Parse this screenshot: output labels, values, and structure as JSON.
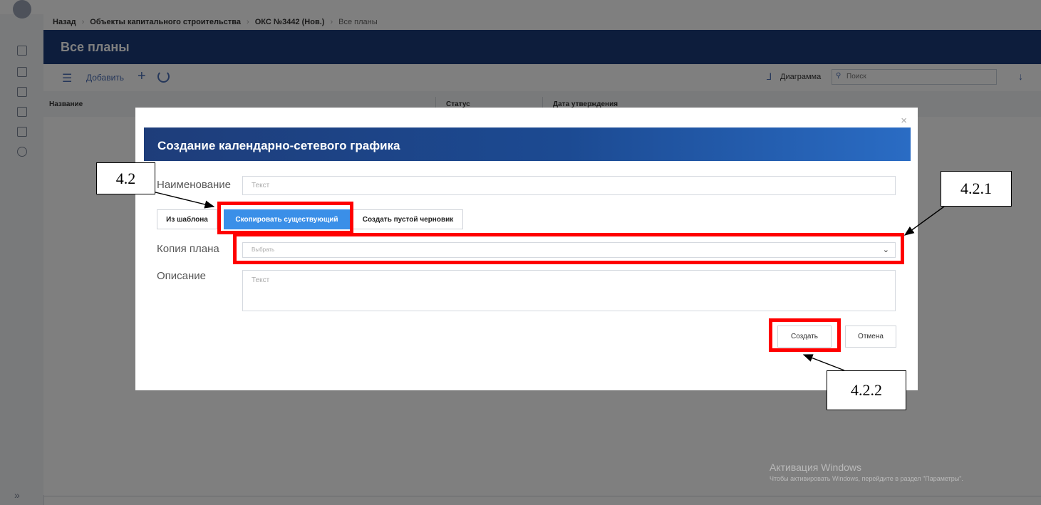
{
  "breadcrumb": {
    "back": "Назад",
    "items": [
      "Объекты капитального строительства",
      "ОКС №3442 (Нов.)"
    ],
    "current": "Все планы"
  },
  "page": {
    "title": "Все планы"
  },
  "toolbar": {
    "add_label": "Добавить",
    "diagram_label": "Диаграмма",
    "search_placeholder": "Поиск"
  },
  "table": {
    "columns": [
      "Название",
      "Статус",
      "Дата утверждения"
    ]
  },
  "modal": {
    "title": "Создание календарно-сетевого графика",
    "name_label": "Наименование",
    "name_placeholder": "Текст",
    "tabs": [
      "Из шаблона",
      "Скопировать существующий",
      "Создать пустой черновик"
    ],
    "active_tab": "Скопировать существующий",
    "copy_label": "Копия плана",
    "copy_placeholder": "Выбрать",
    "desc_label": "Описание",
    "desc_placeholder": "Текст",
    "create_label": "Создать",
    "cancel_label": "Отмена"
  },
  "annotations": {
    "a1": "4.2",
    "a2": "4.2.1",
    "a3": "4.2.2",
    "color": "#ff0000"
  },
  "watermark": {
    "line1": "Активация Windows",
    "line2": "Чтобы активировать Windows, перейдите в раздел \"Параметры\"."
  },
  "colors": {
    "header_blue": "#1a3a78",
    "active_tab": "#3a8fe8",
    "overlay": "rgba(0,0,0,0.5)"
  },
  "icons": [
    "filter-icon",
    "plus-icon",
    "refresh-icon",
    "diagram-icon",
    "search-icon",
    "download-icon",
    "close-icon",
    "chevron-down-icon"
  ]
}
